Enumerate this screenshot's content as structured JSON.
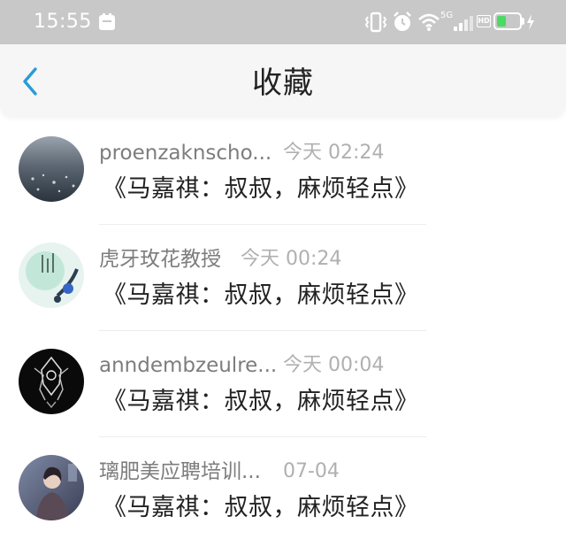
{
  "status_bar": {
    "time": "15:55",
    "network": "5G",
    "hd_badge": "HD"
  },
  "header": {
    "title": "收藏"
  },
  "favorites": [
    {
      "author": "proenzaknscho...",
      "time": "今天 02:24",
      "title": "《马嘉祺：叔叔，麻烦轻点》"
    },
    {
      "author": "虎牙玫花教授",
      "time": "今天 00:24",
      "title": "《马嘉祺：叔叔，麻烦轻点》"
    },
    {
      "author": "anndembzeulre...",
      "time": "今天 00:04",
      "title": "《马嘉祺：叔叔，麻烦轻点》"
    },
    {
      "author": "璃肥美应聘培训...",
      "time": "07-04",
      "title": "《马嘉祺：叔叔，麻烦轻点》"
    }
  ],
  "colors": {
    "status_bar_bg": "#c8c8c8",
    "accent_back": "#2a9bd8",
    "battery_level": "#4cd964"
  },
  "icons": {
    "back": "chevron-left-icon",
    "notification": "notification-icon",
    "vibrate": "vibrate-icon",
    "alarm": "alarm-icon",
    "wifi": "wifi-icon",
    "signal": "signal-icon",
    "battery": "battery-icon",
    "charging": "charging-icon"
  },
  "battery_level": 0.45
}
